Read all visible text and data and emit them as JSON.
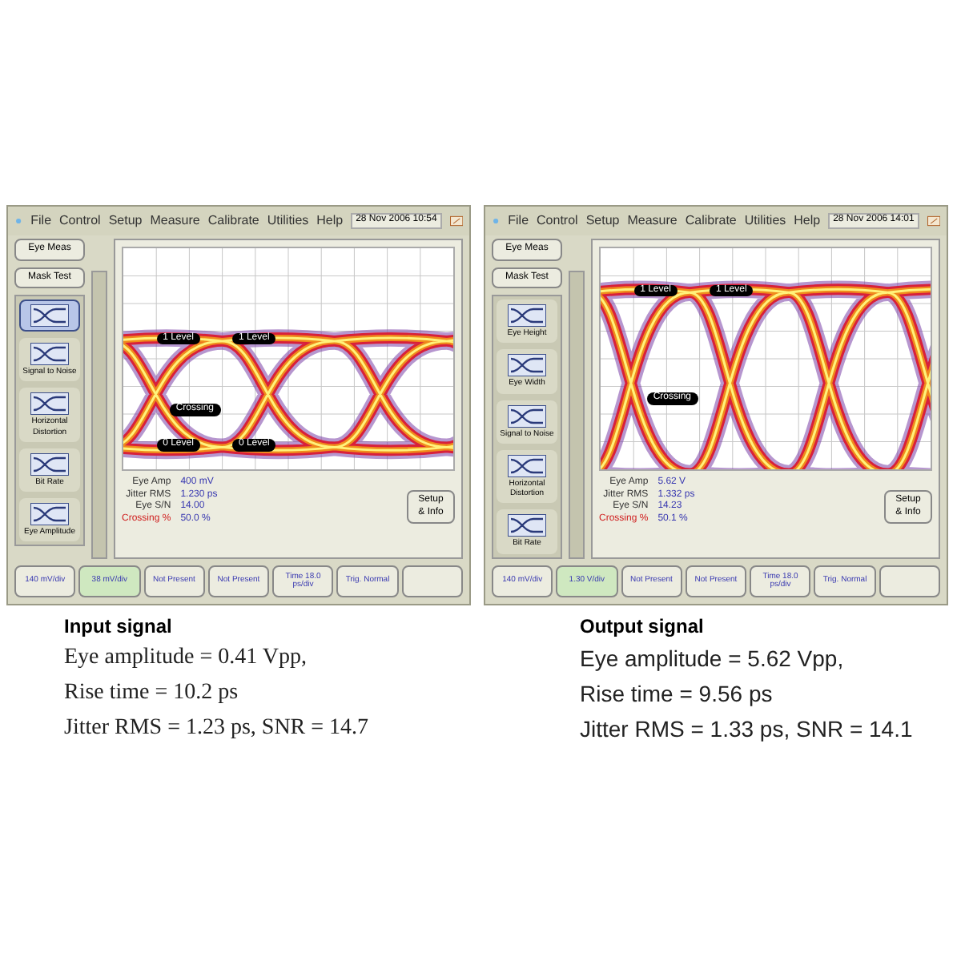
{
  "panels": [
    {
      "menu": [
        "File",
        "Control",
        "Setup",
        "Measure",
        "Calibrate",
        "Utilities",
        "Help"
      ],
      "datetime": "28 Nov 2006 10:54",
      "top_buttons": [
        {
          "label": "Eye Meas"
        },
        {
          "label": "Mask Test"
        }
      ],
      "tools": [
        {
          "selected": true
        },
        {
          "label": "Signal to Noise",
          "selected": false
        },
        {
          "label": "Horizontal Distortion",
          "selected": false
        },
        {
          "label": "Bit Rate",
          "selected": false
        },
        {
          "label": "Eye Amplitude",
          "selected": false
        }
      ],
      "markers": [
        {
          "label": "1 Level",
          "kind": "high"
        },
        {
          "label": "1 Level",
          "kind": "high"
        },
        {
          "label": "Crossing",
          "kind": "crossing"
        },
        {
          "label": "0 Level",
          "kind": "low"
        },
        {
          "label": "0 Level",
          "kind": "low"
        }
      ],
      "measurements": [
        {
          "label": "Eye Amp",
          "value": "400 mV",
          "alert": false
        },
        {
          "label": "Jitter RMS",
          "value": "1.230 ps",
          "alert": false
        },
        {
          "label": "Eye S/N",
          "value": "14.00",
          "alert": false
        },
        {
          "label": "Crossing %",
          "value": "50.0 %",
          "alert": true
        }
      ],
      "setup_button": "Setup & Info",
      "bottom_buttons": [
        {
          "label": "140 mV/div",
          "selected": false
        },
        {
          "label": "38 mV/div",
          "selected": true
        },
        {
          "label": "Not Present",
          "selected": false
        },
        {
          "label": "Not Present",
          "selected": false
        },
        {
          "label": "Time 18.0 ps/div",
          "selected": false
        },
        {
          "label": "Trig. Normal",
          "selected": false
        },
        {
          "selected": false
        }
      ]
    },
    {
      "menu": [
        "File",
        "Control",
        "Setup",
        "Measure",
        "Calibrate",
        "Utilities",
        "Help"
      ],
      "datetime": "28 Nov 2006 14:01",
      "top_buttons": [
        {
          "label": "Eye Meas"
        },
        {
          "label": "Mask Test"
        }
      ],
      "tools": [
        {
          "label": "Eye Height",
          "selected": false
        },
        {
          "label": "Eye Width",
          "selected": false
        },
        {
          "label": "Signal to Noise",
          "selected": false
        },
        {
          "label": "Horizontal Distortion",
          "selected": false
        },
        {
          "label": "Bit Rate",
          "selected": false
        }
      ],
      "markers": [
        {
          "label": "1 Level",
          "kind": "high"
        },
        {
          "label": "1 Level",
          "kind": "high"
        },
        {
          "label": "Crossing",
          "kind": "crossing"
        }
      ],
      "measurements": [
        {
          "label": "Eye Amp",
          "value": "5.62 V",
          "alert": false
        },
        {
          "label": "Jitter RMS",
          "value": "1.332 ps",
          "alert": false
        },
        {
          "label": "Eye S/N",
          "value": "14.23",
          "alert": false
        },
        {
          "label": "Crossing %",
          "value": "50.1 %",
          "alert": true
        }
      ],
      "setup_button": "Setup & Info",
      "bottom_buttons": [
        {
          "label": "140 mV/div",
          "selected": false
        },
        {
          "label": "1.30 V/div",
          "selected": true
        },
        {
          "label": "Not Present",
          "selected": false
        },
        {
          "label": "Not Present",
          "selected": false
        },
        {
          "label": "Time 18.0 ps/div",
          "selected": false
        },
        {
          "label": "Trig. Normal",
          "selected": false
        },
        {
          "selected": false
        }
      ]
    }
  ],
  "captions": [
    {
      "title": "Input signal",
      "kind": "serif",
      "lines": [
        "Eye amplitude = 0.41 Vpp,",
        "Rise time = 10.2 ps",
        "Jitter RMS = 1.23 ps, SNR = 14.7"
      ]
    },
    {
      "title": "Output signal",
      "kind": "sans",
      "lines": [
        "Eye amplitude = 5.62 Vpp,",
        "Rise time = 9.56 ps",
        "Jitter RMS = 1.33 ps, SNR = 14.1"
      ]
    }
  ]
}
